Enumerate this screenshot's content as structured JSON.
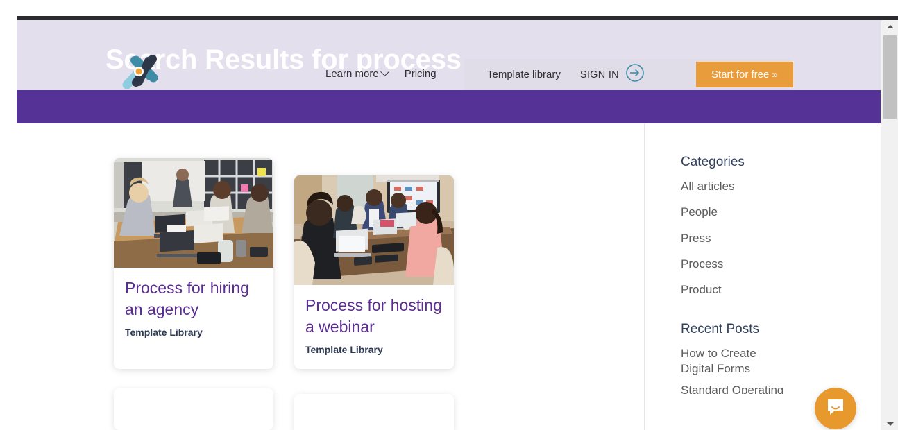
{
  "browser": {
    "scrollbar": {
      "up_arrow": "scroll-up",
      "down_arrow": "scroll-down"
    }
  },
  "header": {
    "logo_name": "pipefy-x-logo",
    "hero_prefix": "Search Results for ",
    "hero_term": "process",
    "hero_full": "Search Results for process",
    "nav": [
      {
        "label": "Learn more",
        "has_dropdown": true
      },
      {
        "label": "Pricing",
        "has_dropdown": false
      }
    ],
    "nav_right": [
      {
        "label": "Template library"
      }
    ],
    "sign_in": "SIGN IN",
    "cta": "Start for free »",
    "colors": {
      "header_bg": "#E3DFED",
      "band": "#553396",
      "cta": "#E89C3C"
    }
  },
  "results": {
    "cards": [
      {
        "title": "Process for hiring an agency",
        "tag": "Template Library",
        "image_alt": "meeting-room-presentation-photo"
      },
      {
        "title": "Process for hosting a webinar",
        "tag": "Template Library",
        "image_alt": "conference-table-webinar-photo"
      }
    ]
  },
  "sidebar": {
    "categories_heading": "Categories",
    "categories": [
      "All articles",
      "People",
      "Press",
      "Process",
      "Product"
    ],
    "recent_heading": "Recent Posts",
    "recent_posts": [
      "How to Create Digital Forms",
      "Standard Operating"
    ]
  },
  "chat": {
    "name": "messenger-launcher",
    "icon": "chat-bubble-icon"
  }
}
